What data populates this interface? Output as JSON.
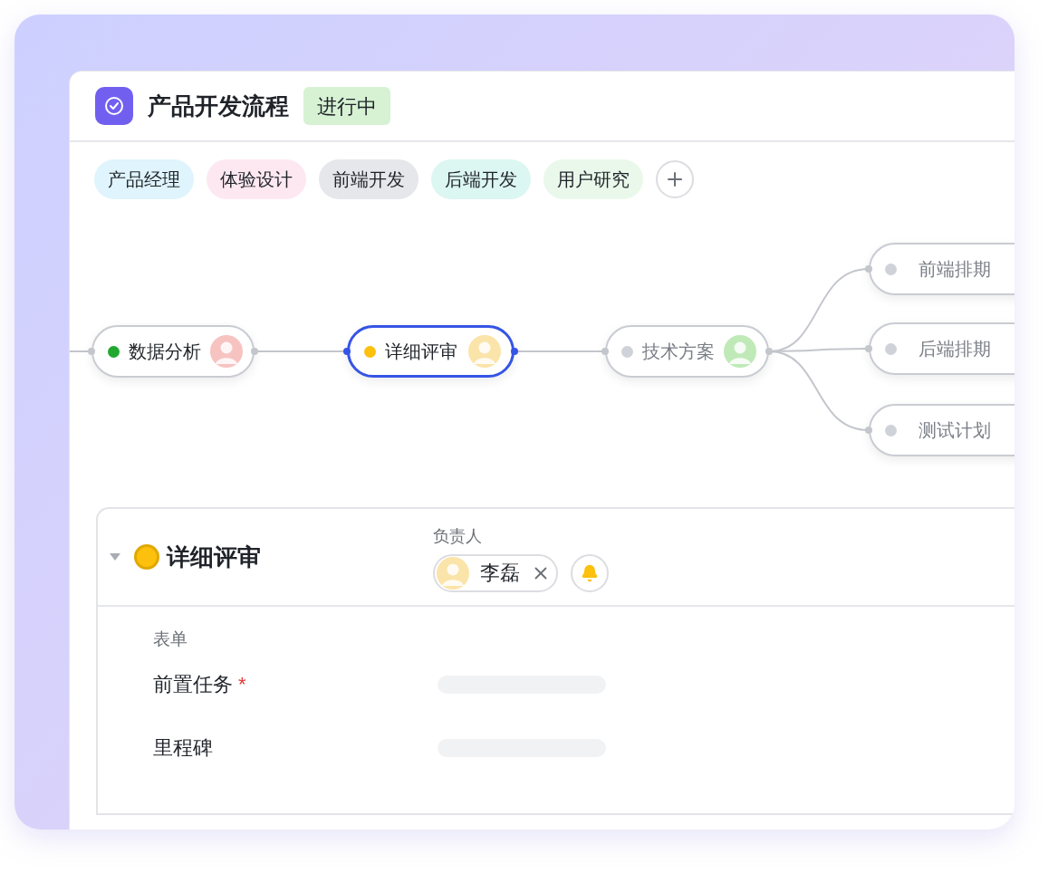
{
  "header": {
    "title": "产品开发流程",
    "status": "进行中"
  },
  "roles": [
    {
      "label": "产品经理",
      "color": "#dff4fc"
    },
    {
      "label": "体验设计",
      "color": "#fde8f1"
    },
    {
      "label": "前端开发",
      "color": "#e6e7ea"
    },
    {
      "label": "后端开发",
      "color": "#dcf6f2"
    },
    {
      "label": "用户研究",
      "color": "#e9f8ea"
    }
  ],
  "flow": {
    "nodes": [
      {
        "label": "数据分析",
        "color": "#22a82f",
        "disabled": false,
        "selected": false
      },
      {
        "label": "详细评审",
        "color": "#fcc00d",
        "disabled": false,
        "selected": true
      },
      {
        "label": "技术方案",
        "color": "#cfd2d8",
        "disabled": true,
        "selected": false
      }
    ],
    "branches": [
      {
        "label": "前端排期",
        "color": "#cfd2d8",
        "disabled": true
      },
      {
        "label": "后端排期",
        "color": "#cfd2d8",
        "disabled": true
      },
      {
        "label": "测试计划",
        "color": "#cfd2d8",
        "disabled": true
      }
    ]
  },
  "detail": {
    "title": "详细评审",
    "expanded": true,
    "color": "#fcc00d",
    "owner_label": "负责人",
    "owner": {
      "name": "李磊"
    },
    "form_label": "表单",
    "fields": [
      {
        "label": "前置任务",
        "marker": "*"
      },
      {
        "label": "里程碑"
      }
    ]
  }
}
